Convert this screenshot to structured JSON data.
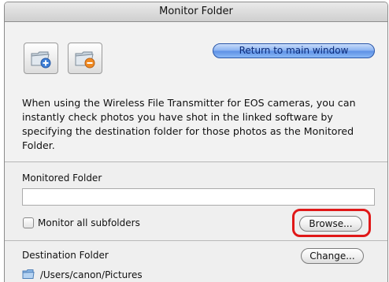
{
  "window": {
    "title": "Monitor Folder"
  },
  "toolbar": {
    "add_folder_icon": "folder-add-icon",
    "remove_folder_icon": "folder-remove-icon",
    "return_label": "Return to main window"
  },
  "description": "When using the Wireless File Transmitter for EOS cameras, you can instantly check photos you have shot in the linked software by specifying the destination folder for those photos as the Monitored Folder.",
  "monitored": {
    "label": "Monitored Folder",
    "value": "",
    "checkbox_label": "Monitor all subfolders",
    "checkbox_checked": false,
    "browse_label": "Browse..."
  },
  "destination": {
    "label": "Destination Folder",
    "change_label": "Change...",
    "path": "/Users/canon/Pictures",
    "folder_icon": "folder-icon"
  },
  "colors": {
    "highlight": "#e01818",
    "accent_button": "#6a9be8"
  }
}
